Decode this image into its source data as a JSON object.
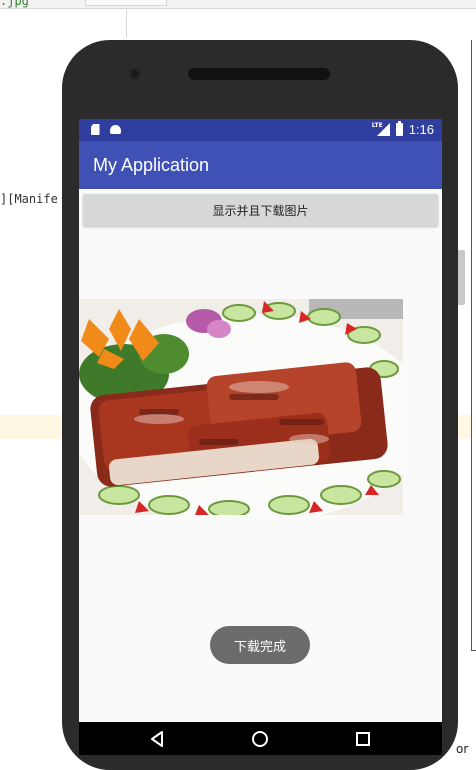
{
  "ide": {
    "top_tab_text": ".jpg",
    "code_line": "][Manife",
    "bottom_text": "or"
  },
  "statusbar": {
    "time": "1:16",
    "network": "LTE"
  },
  "app": {
    "title": "My Application",
    "button_label": "显示并且下载图片",
    "toast": "下载完成"
  },
  "icons": {
    "status_left": [
      "sd-card-icon",
      "android-icon"
    ],
    "status_right": [
      "lte-signal-icon",
      "battery-icon"
    ],
    "navigation": [
      "back-icon",
      "home-icon",
      "recents-icon"
    ]
  },
  "colors": {
    "status_bar": "#303f9f",
    "app_bar": "#3f51b5",
    "button": "#d6d7d7",
    "toast": "#6b6b6b",
    "nav_bar": "#000000"
  }
}
